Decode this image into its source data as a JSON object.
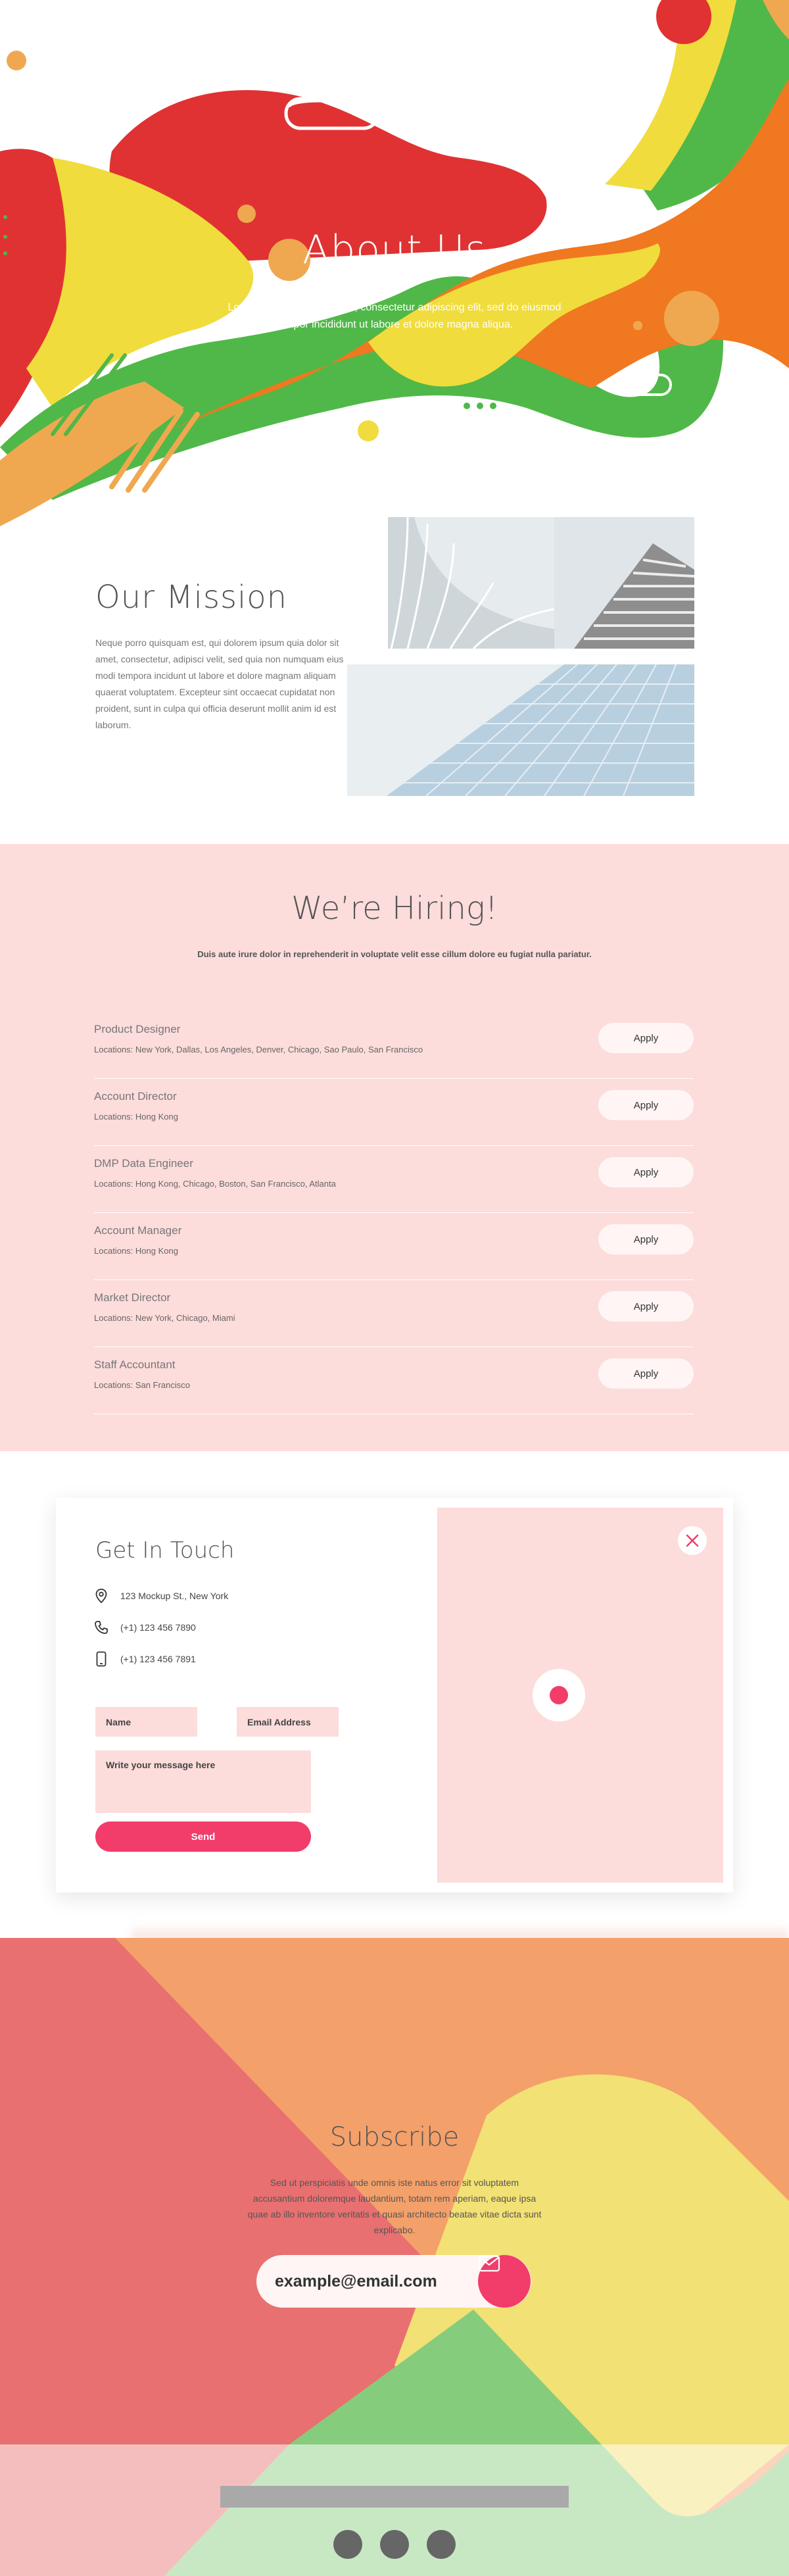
{
  "hero": {
    "title": "About Us",
    "subtitle": "Lorem ipsum dolor sit amet, consectetur adipiscing elit, sed do eiusmod tempor incididunt ut labore et dolore magna aliqua."
  },
  "mission": {
    "title": "Our Mission",
    "body": "Neque porro quisquam est, qui dolorem ipsum quia dolor sit amet, consectetur, adipisci velit, sed quia non numquam eius modi tempora incidunt ut labore et dolore magnam aliquam quaerat voluptatem. Excepteur sint occaecat cupidatat non proident, sunt in culpa qui officia deserunt mollit anim id est laborum."
  },
  "hiring": {
    "title": "We’re Hiring!",
    "subtitle": "Duis aute irure dolor in reprehenderit in voluptate velit esse cillum dolore eu fugiat nulla pariatur.",
    "apply_label": "Apply",
    "jobs": [
      {
        "title": "Product Designer",
        "locations": "Locations: New York, Dallas, Los Angeles, Denver, Chicago, Sao Paulo, San Francisco"
      },
      {
        "title": "Account Director",
        "locations": "Locations: Hong Kong"
      },
      {
        "title": "DMP Data Engineer",
        "locations": "Locations: Hong Kong, Chicago, Boston, San Francisco, Atlanta"
      },
      {
        "title": "Account Manager",
        "locations": "Locations: Hong Kong"
      },
      {
        "title": "Market Director",
        "locations": "Locations: New York, Chicago, Miami"
      },
      {
        "title": "Staff Accountant",
        "locations": "Locations: San Francisco"
      }
    ]
  },
  "contact": {
    "title": "Get In Touch",
    "address": "123 Mockup St., New York",
    "phone": "(+1) 123 456 7890",
    "mobile": "(+1) 123 456 7891",
    "name_placeholder": "Name",
    "email_placeholder": "Email Address",
    "message_placeholder": "Write your message here",
    "send_label": "Send"
  },
  "subscribe": {
    "title": "Subscribe",
    "text": "Sed ut perspiciatis unde omnis iste natus error sit voluptatem accusantium doloremque laudantium, totam rem aperiam, eaque ipsa quae ab illo inventore veritatis et quasi architecto beatae vitae dicta sunt explicabo.",
    "email_value": "example@email.com"
  },
  "colors": {
    "accent": "#f23c6a",
    "pink_bg": "#fddcdc",
    "red": "#e03232",
    "yellow": "#f0dc3c",
    "orange": "#f07820",
    "green": "#50b848"
  },
  "icons": [
    "location-pin-icon",
    "phone-icon",
    "mobile-icon",
    "close-icon",
    "mail-icon"
  ]
}
